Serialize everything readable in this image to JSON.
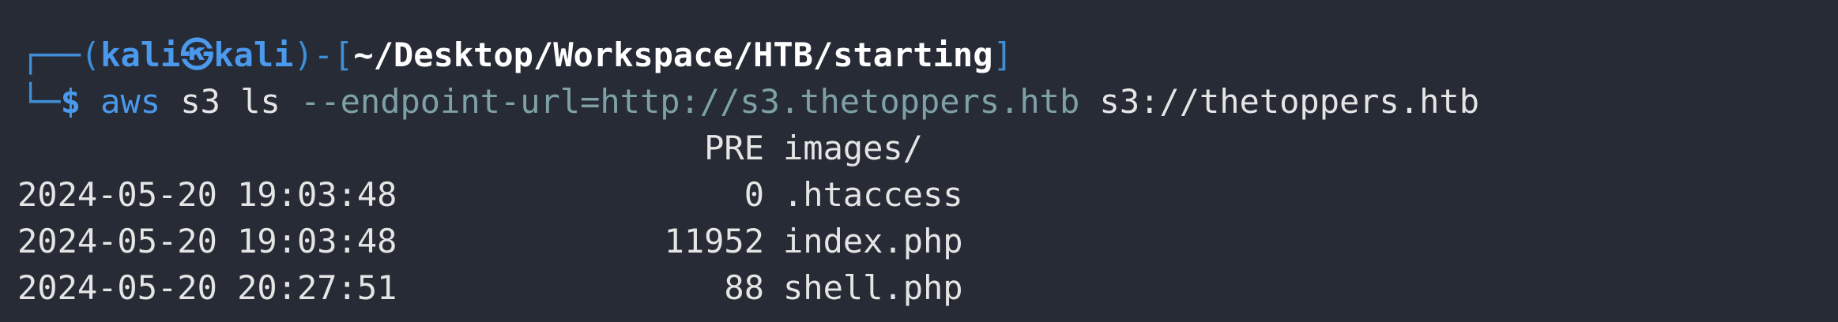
{
  "prompt": {
    "box_top": "┌──(",
    "user": "kali",
    "at_symbol": "㉿",
    "host": "kali",
    "box_mid": ")-[",
    "path": "~/Desktop/Workspace/HTB/starting",
    "box_end": "]",
    "box_bottom": "└─",
    "dollar": "$"
  },
  "command": {
    "cmd": "aws",
    "arg1": "s3",
    "arg2": "ls",
    "option": "--endpoint-url=http://s3.thetoppers.htb",
    "arg3": "s3://thetoppers.htb"
  },
  "output": {
    "rows": [
      {
        "date": "",
        "size": "PRE",
        "name": "images/"
      },
      {
        "date": "2024-05-20 19:03:48",
        "size": "0",
        "name": ".htaccess"
      },
      {
        "date": "2024-05-20 19:03:48",
        "size": "11952",
        "name": "index.php"
      },
      {
        "date": "2024-05-20 20:27:51",
        "size": "88",
        "name": "shell.php"
      }
    ]
  },
  "colors": {
    "background": "#272b36",
    "prompt_blue": "#4a99ec",
    "path_white": "#ffffff",
    "option_teal": "#7ea1a6",
    "text": "#e5e5e5"
  }
}
